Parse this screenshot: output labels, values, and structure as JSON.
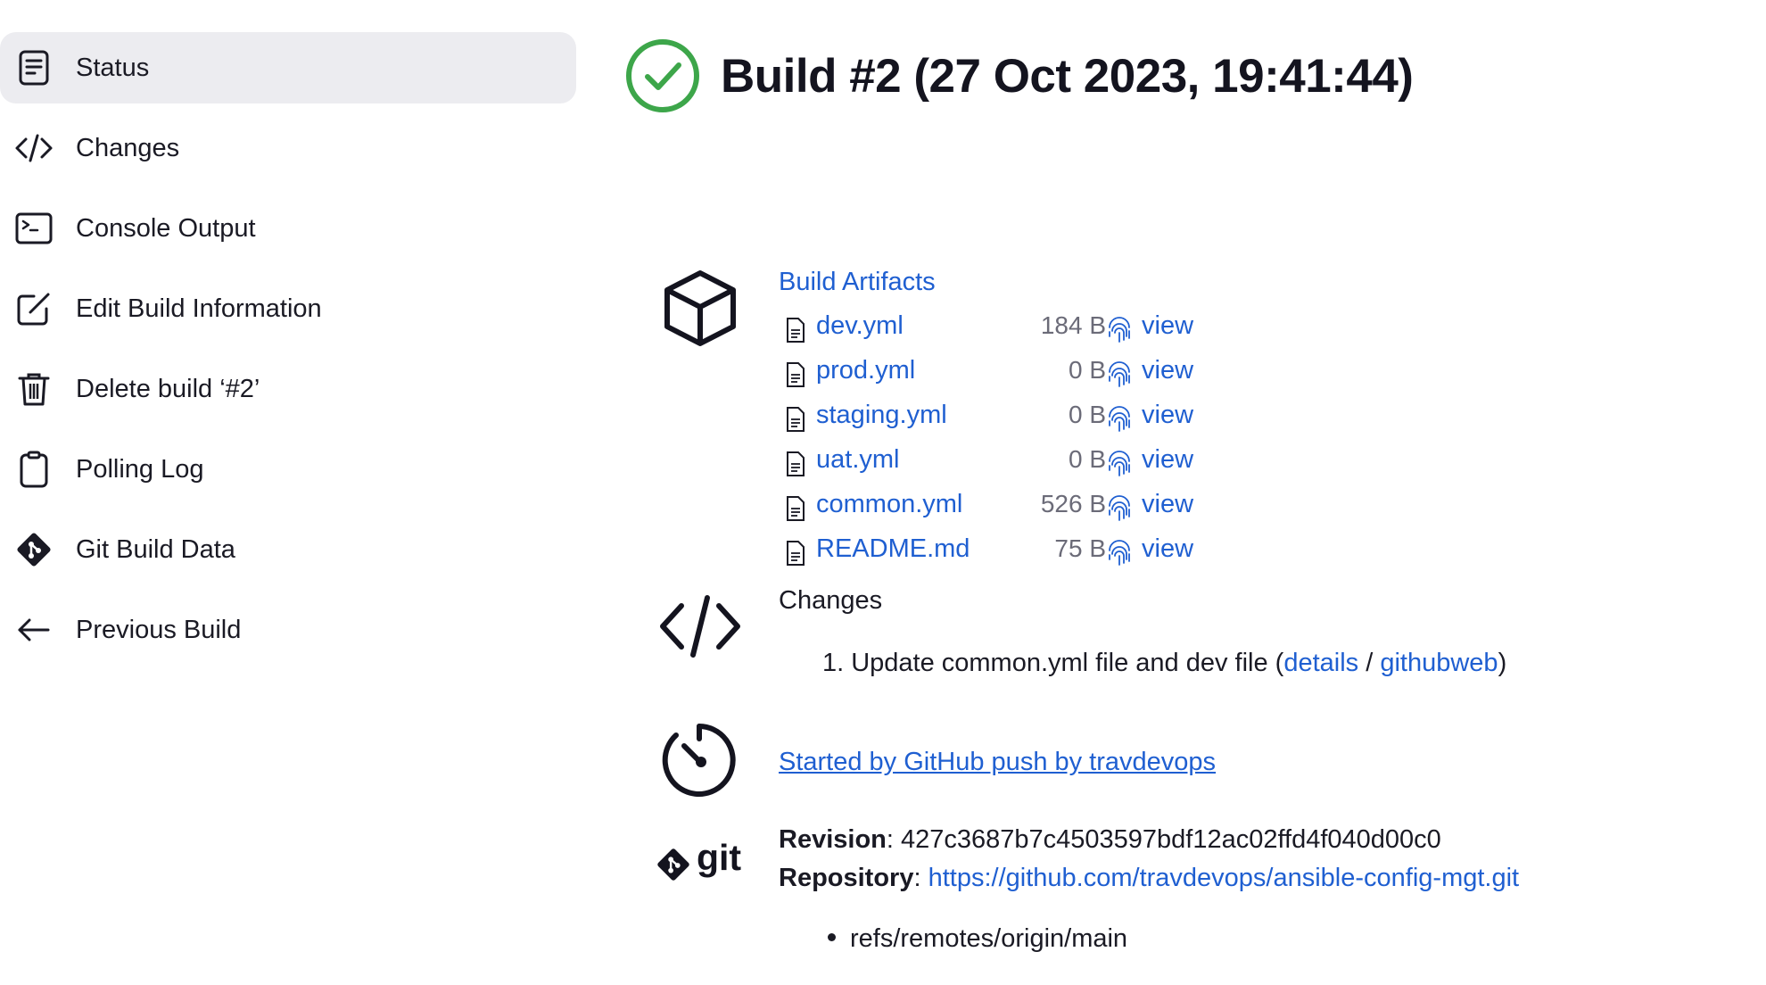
{
  "sidebar": {
    "items": [
      {
        "label": "Status",
        "icon": "document-icon",
        "active": true
      },
      {
        "label": "Changes",
        "icon": "code-icon"
      },
      {
        "label": "Console Output",
        "icon": "terminal-icon"
      },
      {
        "label": "Edit Build Information",
        "icon": "edit-icon"
      },
      {
        "label": "Delete build ‘#2’",
        "icon": "trash-icon"
      },
      {
        "label": "Polling Log",
        "icon": "clipboard-icon"
      },
      {
        "label": "Git Build Data",
        "icon": "git-icon"
      },
      {
        "label": "Previous Build",
        "icon": "arrow-left-icon"
      }
    ]
  },
  "header": {
    "title": "Build #2 (27 Oct 2023, 19:41:44)",
    "status_color": "#3da64a"
  },
  "artifacts": {
    "title": "Build Artifacts",
    "files": [
      {
        "name": "dev.yml",
        "size": "184 B",
        "action": "view"
      },
      {
        "name": "prod.yml",
        "size": "0 B",
        "action": "view"
      },
      {
        "name": "staging.yml",
        "size": "0 B",
        "action": "view"
      },
      {
        "name": "uat.yml",
        "size": "0 B",
        "action": "view"
      },
      {
        "name": "common.yml",
        "size": "526 B",
        "action": "view"
      },
      {
        "name": "README.md",
        "size": "75 B",
        "action": "view"
      }
    ]
  },
  "changes": {
    "title": "Changes",
    "items": [
      {
        "number": "1.",
        "text": "Update common.yml file and dev file (",
        "details": "details",
        "sep": " / ",
        "githubweb": "githubweb",
        "close": ")"
      }
    ]
  },
  "cause": {
    "text": "Started by GitHub push by travdevops"
  },
  "git": {
    "logo_text": "git",
    "revision_label": "Revision",
    "revision": "427c3687b7c4503597bdf12ac02ffd4f040d00c0",
    "repository_label": "Repository",
    "repository": "https://github.com/travdevops/ansible-config-mgt.git",
    "branches": [
      "refs/remotes/origin/main"
    ]
  },
  "colors": {
    "link": "#1f5fd1",
    "active_bg": "#ececf0",
    "text": "#1a1a24"
  }
}
